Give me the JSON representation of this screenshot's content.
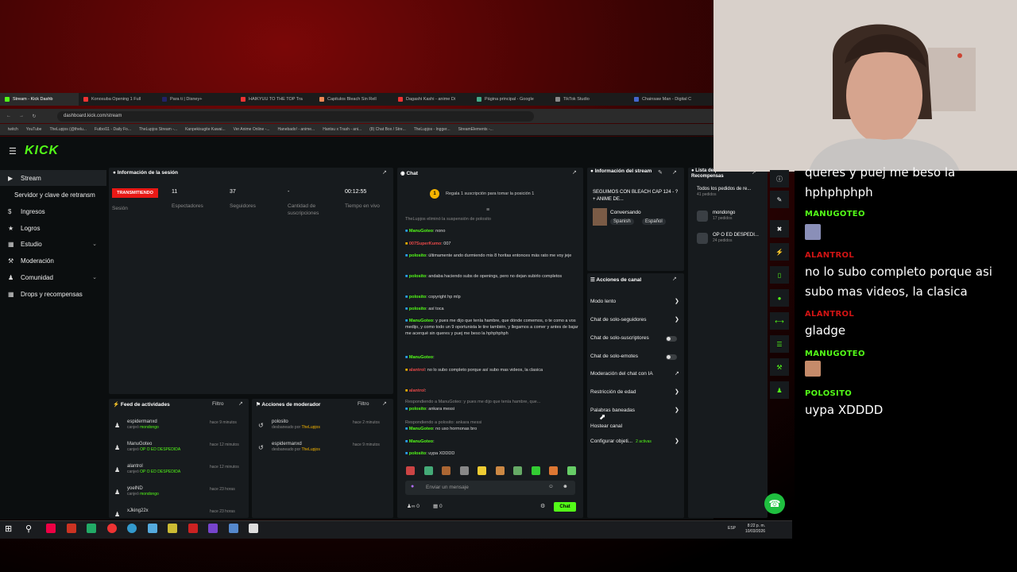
{
  "browser": {
    "tabs": [
      "Stream - Kick Dashb",
      "Konosuba Opening 1 Full",
      "Para ti | Disney+",
      "HAIKYUU TO THE TOP Tra",
      "Capitulos Bleach Sin Rell",
      "Dagashi Kashi - anime Di",
      "Página principal - Google",
      "TikTok Studio",
      "Chainsaw Man - Digital C"
    ],
    "url": "dashboard.kick.com/stream",
    "bookmarks": [
      "twitch",
      "YouTube",
      "TheLupjos (@thelu...",
      "Futbol11 - Daily Fo...",
      "TheLupjos Stream -...",
      "Kanpekisugite Kawai...",
      "Ver Anime Online -...",
      "Hanebado! - anime...",
      "Hantsu x Trash - ani...",
      "(8) Chat Box / Stre...",
      "TheLupjos - Ingger...",
      "StreamElements -..."
    ]
  },
  "brand": {
    "logo": "KICK",
    "accent": "#53fc18"
  },
  "sidebar": {
    "items": [
      {
        "label": "Stream",
        "icon": "stream-icon",
        "active": true
      },
      {
        "label": "Servidor y clave de retransm",
        "icon": ""
      },
      {
        "label": "Ingresos",
        "icon": "money-icon"
      },
      {
        "label": "Logros",
        "icon": "trophy-icon"
      },
      {
        "label": "Estudio",
        "icon": "studio-icon",
        "expandable": true
      },
      {
        "label": "Moderación",
        "icon": "wrench-icon"
      },
      {
        "label": "Comunidad",
        "icon": "community-icon",
        "expandable": true
      },
      {
        "label": "Drops y recompensas",
        "icon": "gift-icon"
      }
    ]
  },
  "session": {
    "title": "Información de la sesión",
    "status": "TRANSMITIENDO",
    "session_label": "Sesión",
    "stats": [
      {
        "value": "11",
        "label": "Espectadores"
      },
      {
        "value": "37",
        "label": "Seguidores"
      },
      {
        "value": "-",
        "label": "Cantidad de suscripciones"
      },
      {
        "value": "00:12:55",
        "label": "Tiempo en vivo"
      }
    ]
  },
  "activity": {
    "title": "Feed de actividades",
    "filter": "Filtro",
    "rows": [
      {
        "user": "espidermanxd",
        "action": "canjeó",
        "item": "mondongo",
        "time": "hace 9 minutos"
      },
      {
        "user": "ManuGoteo",
        "action": "canjeó",
        "item": "OP O ED DESPEDIDA",
        "time": "hace 12 minutos"
      },
      {
        "user": "alantrol",
        "action": "canjeó",
        "item": "OP O ED DESPEDIDA",
        "time": "hace 12 minutos"
      },
      {
        "user": "yoelND",
        "action": "canjeó",
        "item": "mondongo",
        "time": "hace 23 horas"
      },
      {
        "user": "xJking22x",
        "action": "",
        "item": "",
        "time": "hace 23 horas"
      }
    ]
  },
  "modactions": {
    "title": "Acciones de moderador",
    "filter": "Filtro",
    "rows": [
      {
        "user": "polosito",
        "action": "desbaneado por",
        "by": "TheLupjos",
        "time": "hace 2 minutos"
      },
      {
        "user": "espidermanxd",
        "action": "desbaneado por",
        "by": "TheLupjos",
        "time": "hace 9 minutos"
      }
    ]
  },
  "chat": {
    "title": "Chat",
    "pinned_rank": "1",
    "pinned": "Regala 1 suscripción para tomar la posición 1",
    "messages": [
      {
        "user": "",
        "text": "TheLupjos eliminó la suspensión de polosito",
        "kind": "system"
      },
      {
        "user": "ManuGoteo",
        "text": ": nono",
        "kind": "green"
      },
      {
        "user": "007SuperKumo",
        "text": ": 007",
        "kind": "red"
      },
      {
        "user": "polosito",
        "text": ": últimamente ando durmiendo mis 8 horitas entonces más rato me voy jeje",
        "kind": "green"
      },
      {
        "user": "polosito",
        "text": ": andaba haciendo subs de openings, pero no dejan subirlo completos",
        "kind": "green"
      },
      {
        "user": "polosito",
        "text": ": copyright hp mlp",
        "kind": "green"
      },
      {
        "user": "polosito",
        "text": ": así toca",
        "kind": "green"
      },
      {
        "user": "ManuGoteo",
        "text": ": y pues me dijo que tenía hambre, que dónde comemos, o te como a vos medijo, y como todo un 9 oportunista le tire también, y llegamos a comer y antes de bajar me acerqué sin queres y puej me beso la hphphphph",
        "kind": "green"
      },
      {
        "user": "ManuGoteo",
        "text": ":",
        "kind": "green"
      },
      {
        "user": "alantrol",
        "text": ": no lo subo completo porque así subo mas videos, la clasica",
        "kind": "red"
      },
      {
        "user": "alantrol",
        "text": ":",
        "kind": "red"
      },
      {
        "user": "",
        "text": "Respondiendo a ManuGoteo: y pues me dijo que tenía hambre, que...",
        "kind": "system"
      },
      {
        "user": "ManuGoteo",
        "text": ": no uso hormonas bro",
        "kind": "green"
      },
      {
        "user": "ManuGoteo",
        "text": ":",
        "kind": "green"
      },
      {
        "user": "polosito",
        "text": ": ankara messi",
        "kind": "green"
      },
      {
        "user": "",
        "text": "Respondiendo a polosito: ankara messi",
        "kind": "system"
      },
      {
        "user": "polosito",
        "text": ": uypa XDDDD",
        "kind": "green"
      }
    ],
    "input_placeholder": "Enviar un mensaje",
    "send_label": "Chat",
    "counts": {
      "viewers": "0",
      "gifts": "0"
    }
  },
  "stream_info": {
    "title": "Información del stream",
    "stream_title": "SEGUIMOS CON BLEACH CAP 124 - ? + ANIME DE...",
    "category": "Conversando",
    "tags": [
      "Spanish",
      "Español"
    ]
  },
  "rewards": {
    "title": "Lista de pedidos de Recompensas",
    "all": "Todos los pedidos de re...",
    "all_count": "41 pedidos",
    "items": [
      {
        "name": "mondongo",
        "count": "17 pedidos"
      },
      {
        "name": "OP O ED DESPEDI...",
        "count": "24 pedidos"
      }
    ]
  },
  "channel_actions": {
    "title": "Acciones de canal",
    "rows": [
      {
        "label": "Modo lento",
        "control": "arrow"
      },
      {
        "label": "Chat de solo-seguidores",
        "control": "arrow"
      },
      {
        "label": "Chat de solo-suscriptores",
        "control": "toggle"
      },
      {
        "label": "Chat de solo-emotes",
        "control": "toggle"
      },
      {
        "label": "Moderación del chat con IA",
        "control": "external"
      },
      {
        "label": "Restricción de edad",
        "control": "arrow"
      },
      {
        "label": "Palabras baneadas",
        "control": "arrow"
      },
      {
        "label": "Hostear canal",
        "control": "none"
      },
      {
        "label": "Configurar objeti...",
        "control": "arrow",
        "extra": "2 activas"
      }
    ]
  },
  "overlay_chat": [
    {
      "user": "",
      "text": "queres y puej me beso la hphphphph",
      "color": "#ffffff"
    },
    {
      "user": "MANUGOTEO",
      "text": "",
      "color": "#53fc18",
      "emote": true
    },
    {
      "user": "ALANTROL",
      "text": "no lo subo completo porque asi subo mas videos, la clasica",
      "color": "#d11414"
    },
    {
      "user": "ALANTROL",
      "text": "gladge",
      "color": "#d11414"
    },
    {
      "user": "MANUGOTEO",
      "text": "",
      "color": "#53fc18",
      "emote": true
    },
    {
      "user": "POLOSITO",
      "text": "uypa XDDDD",
      "color": "#53fc18"
    }
  ],
  "taskbar": {
    "time": "8:22 p. m.",
    "date": "10/03/2026",
    "lang": "ESP"
  }
}
